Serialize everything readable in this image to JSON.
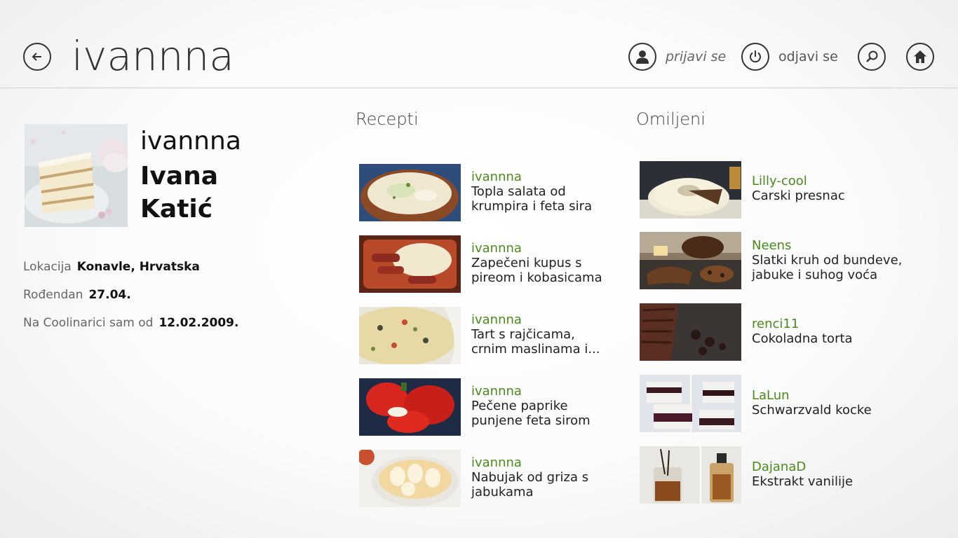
{
  "header": {
    "title": "ivannna",
    "login_label": "prijavi se",
    "logout_label": "odjavi se"
  },
  "profile": {
    "username": "ivannna",
    "first_name": "Ivana",
    "last_name": "Katić",
    "info": [
      {
        "label": "Lokacija",
        "value": "Konavle, Hrvatska"
      },
      {
        "label": "Rođendan",
        "value": "27.04."
      },
      {
        "label": "Na Coolinarici sam od",
        "value": "12.02.2009."
      }
    ]
  },
  "recepti": {
    "title": "Recepti",
    "items": [
      {
        "author": "ivannna",
        "name_line1": "Topla salata od",
        "name_line2": "krumpira i feta sira"
      },
      {
        "author": "ivannna",
        "name_line1": "Zapečeni kupus s",
        "name_line2": "pireom i kobasicama"
      },
      {
        "author": "ivannna",
        "name_line1": "Tart s rajčicama,",
        "name_line2": "crnim maslinama i..."
      },
      {
        "author": "ivannna",
        "name_line1": "Pečene paprike",
        "name_line2": "punjene feta sirom"
      },
      {
        "author": "ivannna",
        "name_line1": "Nabujak od griza s",
        "name_line2": "jabukama"
      }
    ]
  },
  "omiljeni": {
    "title": "Omiljeni",
    "items": [
      {
        "author": "Lilly-cool",
        "name_line1": "Carski presnac",
        "name_line2": ""
      },
      {
        "author": "Neens",
        "name_line1": "Slatki kruh od bundeve,",
        "name_line2": "jabuke i suhog voća"
      },
      {
        "author": "renci11",
        "name_line1": "Cokoladna torta",
        "name_line2": ""
      },
      {
        "author": "LaLun",
        "name_line1": "Schwarzvald kocke",
        "name_line2": ""
      },
      {
        "author": "DajanaD",
        "name_line1": "Ekstrakt vanilije",
        "name_line2": ""
      }
    ]
  },
  "icons": {
    "back": "arrow-left-icon",
    "login": "user-icon",
    "logout": "power-icon",
    "search": "search-icon",
    "home": "home-icon"
  },
  "colors": {
    "author": "#4a8c1c",
    "text": "#222222"
  }
}
